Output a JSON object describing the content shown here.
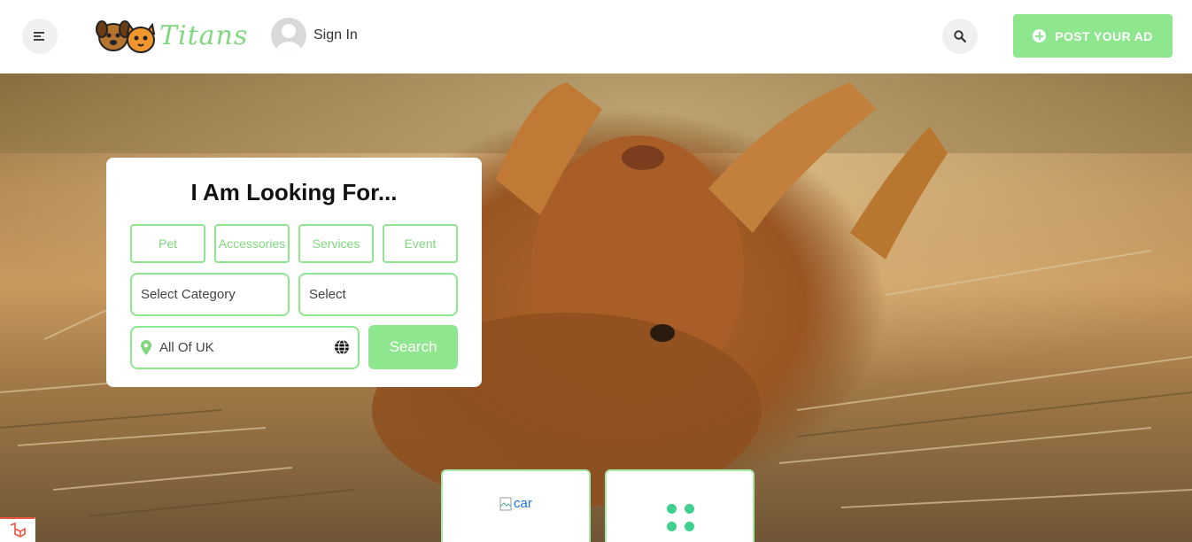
{
  "header": {
    "logo_text": "Titans",
    "signin_label": "Sign In",
    "post_ad_label": "POST YOUR AD",
    "menu_icon": "menu-icon",
    "search_icon": "search-icon"
  },
  "search_card": {
    "title": "I Am Looking For...",
    "tabs": [
      "Pet",
      "Accessories",
      "Services",
      "Event"
    ],
    "category_placeholder": "Select Category",
    "sub_placeholder": "Select",
    "location_value": "All Of UK",
    "search_label": "Search"
  },
  "tiles": {
    "car_alt": "car"
  },
  "colors": {
    "accent": "#8ee68e",
    "accent_text": "#7fd87f",
    "dots": "#3fcf8e"
  }
}
